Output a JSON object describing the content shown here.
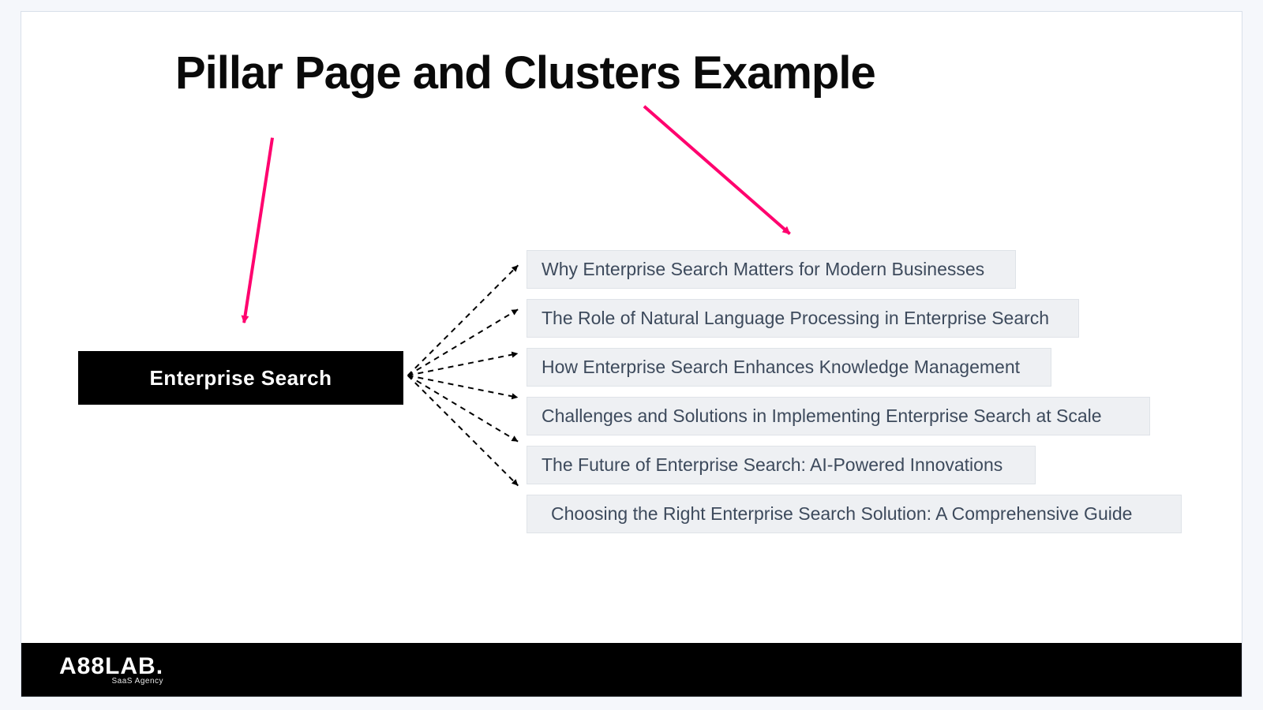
{
  "title": "Pillar Page and Clusters Example",
  "pillar": {
    "label": "Enterprise Search"
  },
  "clusters": [
    "Why Enterprise Search Matters for Modern Businesses",
    "The Role of Natural Language Processing in Enterprise Search",
    "How Enterprise Search Enhances Knowledge Management",
    "Challenges and Solutions in Implementing Enterprise Search at Scale",
    "The Future of Enterprise Search: AI-Powered Innovations",
    "Choosing the Right Enterprise Search Solution: A Comprehensive Guide"
  ],
  "footer": {
    "brand": "A88LAB.",
    "tagline": "SaaS Agency"
  },
  "diagram": {
    "pillar_arrow_color": "#ff006e",
    "connector_style": "dashed"
  }
}
